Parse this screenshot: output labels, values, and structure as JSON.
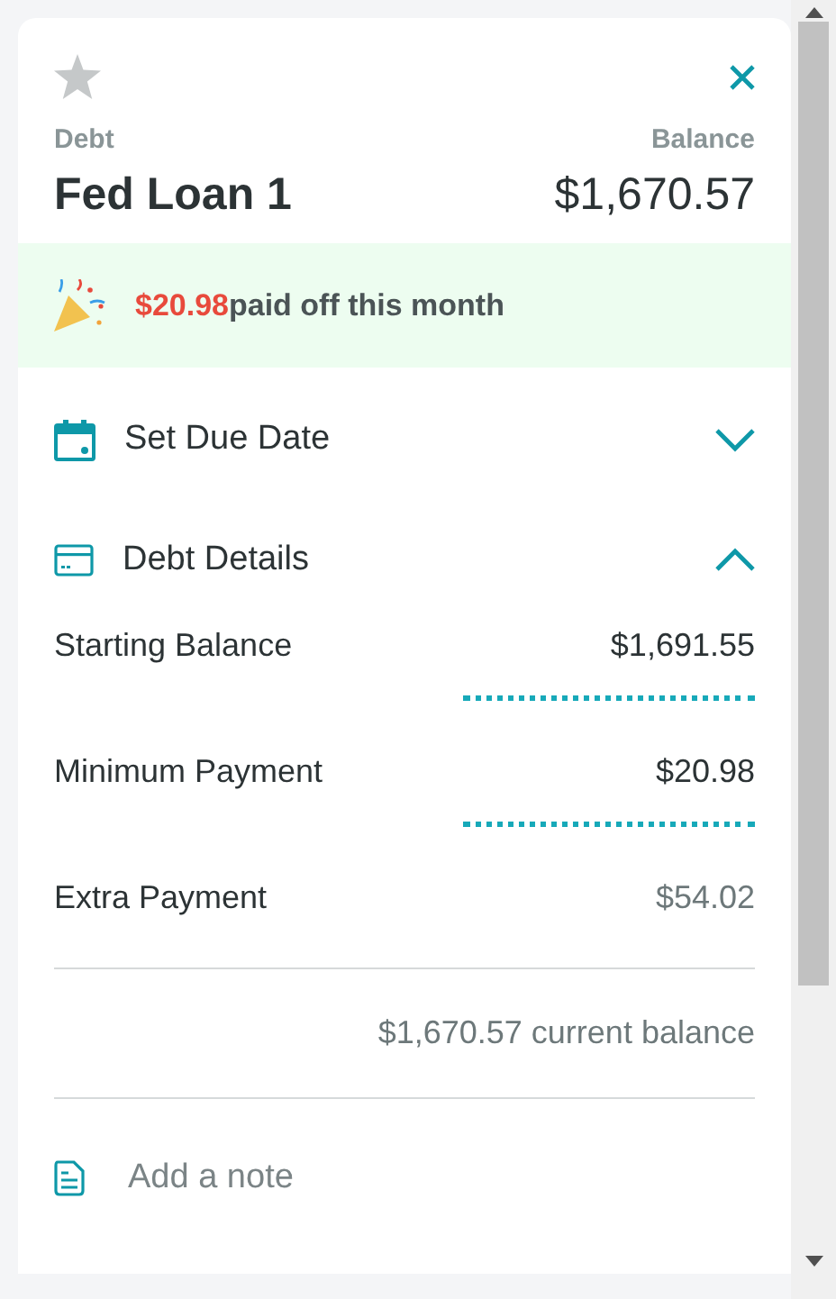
{
  "header": {
    "starred": false,
    "debt_label": "Debt",
    "balance_label": "Balance",
    "debt_name": "Fed Loan 1",
    "balance": "$1,670.57"
  },
  "paid_banner": {
    "amount": "$20.98",
    "text": "paid off this month"
  },
  "sections": [
    {
      "kind": "calendar",
      "title": "Set Due Date",
      "expanded": false
    },
    {
      "kind": "card",
      "title": "Debt Details",
      "expanded": true
    }
  ],
  "details": [
    {
      "label": "Starting Balance",
      "value": "$1,691.55",
      "editable": true
    },
    {
      "label": "Minimum Payment",
      "value": "$20.98",
      "editable": true
    },
    {
      "label": "Extra Payment",
      "value": "$54.02",
      "editable": false
    }
  ],
  "current_balance": "$1,670.57 current balance",
  "note": {
    "placeholder": "Add a note"
  }
}
